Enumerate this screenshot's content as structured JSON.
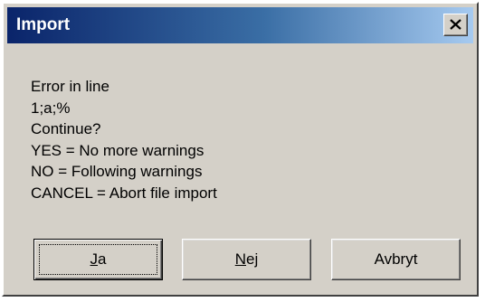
{
  "window": {
    "title": "Import",
    "close_glyph": "×"
  },
  "message": {
    "lines": [
      "Error in line",
      "1;a;%",
      "Continue?",
      "YES = No more warnings",
      "NO = Following warnings",
      "CANCEL = Abort file import"
    ]
  },
  "buttons": {
    "yes": {
      "mnemonic": "J",
      "rest": "a"
    },
    "no": {
      "mnemonic": "N",
      "rest": "ej"
    },
    "cancel": {
      "label": "Avbryt"
    }
  },
  "colors": {
    "title_gradient_start": "#0a246a",
    "title_gradient_end": "#a6caf0",
    "face": "#d4d0c8"
  }
}
